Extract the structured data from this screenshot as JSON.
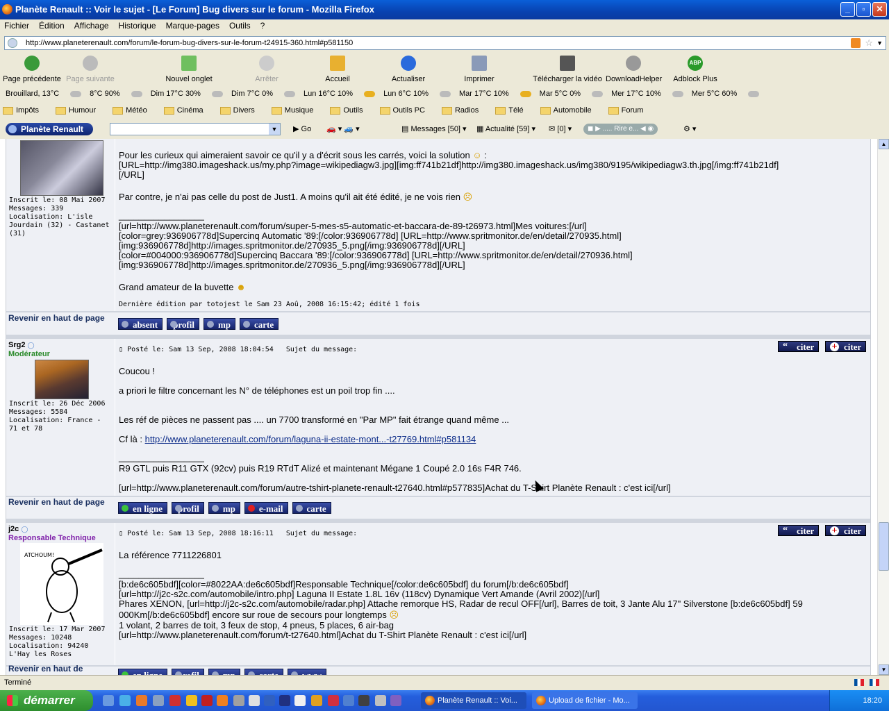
{
  "window": {
    "title": "Planète Renault :: Voir le sujet - [Le Forum] Bug divers sur le forum - Mozilla Firefox"
  },
  "menu": [
    "Fichier",
    "Édition",
    "Affichage",
    "Historique",
    "Marque-pages",
    "Outils",
    "?"
  ],
  "url": "http://www.planeterenault.com/forum/le-forum-bug-divers-sur-le-forum-t24915-360.html#p581150",
  "nav": {
    "back": "Page précédente",
    "forward": "Page suivante",
    "newtab": "Nouvel onglet",
    "stop": "Arrêter",
    "home": "Accueil",
    "reload": "Actualiser",
    "print": "Imprimer",
    "video": "Télécharger la vidéo",
    "dlhelper": "DownloadHelper",
    "abp": "Adblock Plus"
  },
  "weather": [
    "Brouillard, 13°C",
    "8°C 90%",
    "Dim 17°C 30%",
    "Dim 7°C 0%",
    "Lun 16°C 10%",
    "Lun 6°C 10%",
    "Mar 17°C 10%",
    "Mar 5°C 0%",
    "Mer 17°C 10%",
    "Mer 5°C 60%"
  ],
  "bookmarks": [
    "Impôts",
    "Humour",
    "Météo",
    "Cinéma",
    "Divers",
    "Musique",
    "Outils",
    "Outils PC",
    "Radios",
    "Télé",
    "Automobile",
    "Forum"
  ],
  "toolbar": {
    "brand": "Planète Renault",
    "go": "Go",
    "messages": "Messages [50]",
    "news": "Actualité [59]",
    "mail": "[0]",
    "radio": "..... Rire e..."
  },
  "posts": {
    "p1": {
      "joined": "Inscrit le: 08 Mai 2007",
      "messages": "Messages: 339",
      "location": "Localisation: L'isle Jourdain (32) - Castanet (31)",
      "lines": [
        "Pour les curieux qui aimeraient savoir ce qu'il y a d'écrit sous les carrés, voici la solution",
        "[URL=http://img380.imageshack.us/my.php?image=wikipediagw3.jpg][img:ff741b21df]http://img380.imageshack.us/img380/9195/wikipediagw3.th.jpg[/img:ff741b21df]",
        "[/URL]",
        "Par contre, je n'ai pas celle du post de Just1. A moins qu'il ait été édité, je ne vois rien",
        "_________________",
        "[url=http://www.planeterenault.com/forum/super-5-mes-s5-automatic-et-baccara-de-89-t26973.html]Mes voitures:[/url]",
        "[color=grey:936906778d]Supercinq Automatic '89:[/color:936906778d] [URL=http://www.spritmonitor.de/en/detail/270935.html]",
        "[img:936906778d]http://images.spritmonitor.de/270935_5.png[/img:936906778d][/URL]",
        "[color=#004000:936906778d]Supercinq Baccara '89:[/color:936906778d] [URL=http://www.spritmonitor.de/en/detail/270936.html]",
        "[img:936906778d]http://images.spritmonitor.de/270936_5.png[/img:936906778d][/URL]",
        "Grand amateur de la buvette"
      ],
      "edited": "Dernière édition par totojest le Sam 23 Aoû, 2008 16:15:42; édité 1 fois",
      "back": "Revenir en haut de page",
      "buttons": [
        "absent",
        "profil",
        "mp",
        "carte"
      ]
    },
    "p2": {
      "user": "Srg2",
      "rank": "Modérateur",
      "joined": "Inscrit le: 26 Déc 2006",
      "messages": "Messages: 5584",
      "location": "Localisation: France - 71 et 78",
      "posted": "Posté le: Sam 13 Sep, 2008 18:04:54",
      "subject": "Sujet du message:",
      "cite1": "citer",
      "cite2": "citer",
      "lines": [
        "Coucou !",
        "a priori le filtre concernant les N° de téléphones est un poil trop fin ....",
        "Les réf de pièces ne passent pas .... un 7700 transformé en \"Par MP\" fait étrange quand même ...",
        "Cf là :",
        "http://www.planeterenault.com/forum/laguna-ii-estate-mont...-t27769.html#p581134",
        "_________________",
        "R9 GTL puis R11 GTX (92cv) puis R19 RTdT Alizé et maintenant Mégane 1 Coupé 2.0 16s F4R 746.",
        "[url=http://www.planeterenault.com/forum/autre-tshirt-planete-renault-t27640.html#p577835]Achat du T-Shirt Planète Renault : c'est ici[/url]"
      ],
      "back": "Revenir en haut de page",
      "buttons": [
        "en ligne",
        "profil",
        "mp",
        "e-mail",
        "carte"
      ]
    },
    "p3": {
      "user": "j2c",
      "rank": "Responsable Technique",
      "joined": "Inscrit le: 17 Mar 2007",
      "messages": "Messages: 10248",
      "location": "Localisation: 94240 L'Hay les Roses",
      "posted": "Posté le: Sam 13 Sep, 2008 18:16:11",
      "subject": "Sujet du message:",
      "cite1": "citer",
      "cite2": "citer",
      "lines": [
        "La référence 7711226801",
        "_________________",
        "[b:de6c605bdf][color=#8022AA:de6c605bdf]Responsable Technique[/color:de6c605bdf] du forum[/b:de6c605bdf]",
        "[url=http://j2c-s2c.com/automobile/intro.php] Laguna II Estate 1.8L 16v (118cv) Dynamique Vert Amande (Avril 2002)[/url]",
        "Phares XENON, [url=http://j2c-s2c.com/automobile/radar.php] Attache remorque HS, Radar de recul OFF[/url], Barres de toit, 3 Jante Alu 17\" Silverstone [b:de6c605bdf] 59",
        "000Km[/b:de6c605bdf] encore sur roue de secours pour longtemps",
        "1 volant, 2 barres de toit, 3 feux de stop, 4 pneus, 5 places, 6 air-bag",
        "[url=http://www.planeterenault.com/forum/t-t27640.html]Achat du T-Shirt Planète Renault : c'est ici[/url]"
      ],
      "back": "Revenir en haut de",
      "buttons": [
        "en ligne",
        "profil",
        "mp",
        "carte",
        "www"
      ]
    }
  },
  "status": "Terminé",
  "taskbar": {
    "start": "démarrer",
    "task1": "Planète Renault :: Voi...",
    "task2": "Upload de fichier - Mo...",
    "clock": "18:20"
  },
  "colors": {
    "moderator": "#2a8a2a",
    "tech": "#8022AA",
    "titlebar": "#0842b0"
  }
}
